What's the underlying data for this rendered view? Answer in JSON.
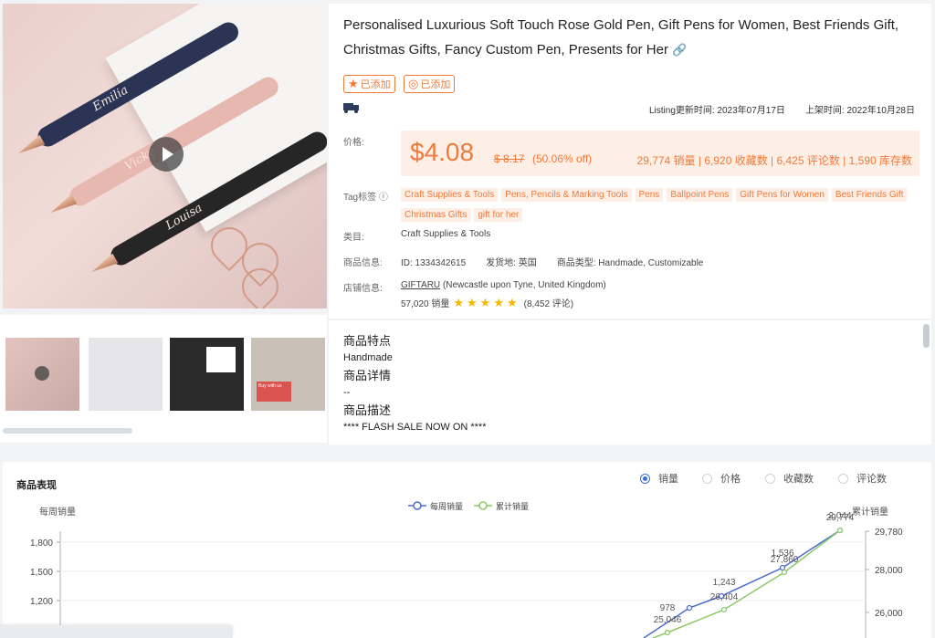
{
  "product": {
    "title": "Personalised Luxurious Soft Touch Rose Gold Pen, Gift Pens for Women, Best Friends Gift, Christmas Gifts, Fancy Custom Pen, Presents for Her",
    "link_icon": "link-icon",
    "favorite_label": "已添加",
    "track_label": "已添加",
    "listing_update": "Listing更新时间: 2023年07月17日",
    "listed_date": "上架时间: 2022年10月28日",
    "price_label": "价格:",
    "price": "$4.08",
    "old_price": "$ 8.17",
    "discount": "(50.06% off)",
    "stats": "29,774 销量 | 6,920 收藏数 | 6,425 评论数 | 1,590 库存数",
    "tag_label": "Tag标签",
    "tags": [
      "Craft Supplies & Tools",
      "Pens, Pencils & Marking Tools",
      "Pens",
      "Ballpoint Pens",
      "Gift Pens for Women",
      "Best Friends Gift",
      "Christmas Gifts",
      "gift for her"
    ],
    "category_label": "类目:",
    "category": "Craft Supplies & Tools",
    "info_label": "商品信息:",
    "id": "ID: 1334342615",
    "ship_from": "发货地: 英国",
    "type": "商品类型: Handmade, Customizable",
    "shop_label": "店铺信息:",
    "shop_name": "GIFTARU",
    "shop_location": "(Newcastle upon Tyne, United Kingdom)",
    "shop_sales": "57,020 销量",
    "shop_stars": "★★★★★",
    "shop_reviews": "(8,452 评论)",
    "image_engravings": [
      "Emilia",
      "Vicky",
      "Louisa"
    ],
    "thumb_card_text": "Buy with us"
  },
  "description": {
    "features_title": "商品特点",
    "features": "Handmade",
    "details_title": "商品详情",
    "details": "--",
    "desc_title": "商品描述",
    "desc": "**** FLASH SALE NOW ON ****"
  },
  "chart_panel": {
    "title": "商品表现",
    "metrics": [
      "销量",
      "价格",
      "收藏数",
      "评论数"
    ],
    "selected_metric": "销量"
  },
  "chart_data": {
    "type": "line",
    "ylabel_left": "每周销量",
    "ylabel_right": "累计销量",
    "left_ticks": [
      "1,800",
      "1,500",
      "1,200"
    ],
    "right_ticks": [
      "29,780",
      "28,000",
      "26,000"
    ],
    "series": [
      {
        "name": "每周销量",
        "color": "#4a6bd0",
        "points": [
          {
            "label": "978"
          },
          {
            "label": "1,243"
          },
          {
            "label": "1,536"
          },
          {
            "label": "2,044"
          }
        ]
      },
      {
        "name": "累计销量",
        "color": "#8dc967",
        "points": [
          {
            "label": "25,046"
          },
          {
            "label": "26,404"
          },
          {
            "label": "27,860"
          },
          {
            "label": "29,774"
          }
        ]
      }
    ]
  }
}
